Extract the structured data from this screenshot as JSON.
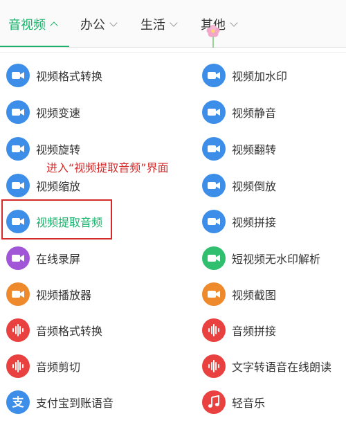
{
  "tabs": [
    {
      "label": "音视频",
      "active": true
    },
    {
      "label": "办公",
      "active": false
    },
    {
      "label": "生活",
      "active": false
    },
    {
      "label": "其他",
      "active": false
    }
  ],
  "colors": {
    "accent": "#19b36b",
    "blue": "#3d8ee8",
    "purple": "#a056d6",
    "green": "#2fbf6e",
    "orange": "#ee8a2c",
    "red": "#e8413f",
    "annotation": "#d42a2a"
  },
  "left_items": [
    {
      "label": "视频格式转换",
      "icon": "video-camera-icon",
      "color": "blue"
    },
    {
      "label": "视频变速",
      "icon": "video-camera-icon",
      "color": "blue"
    },
    {
      "label": "视频旋转",
      "icon": "video-camera-icon",
      "color": "blue"
    },
    {
      "label": "视频缩放",
      "icon": "video-camera-icon",
      "color": "blue"
    },
    {
      "label": "视频提取音频",
      "icon": "video-camera-icon",
      "color": "blue",
      "highlighted": true
    },
    {
      "label": "在线录屏",
      "icon": "video-camera-icon",
      "color": "purple"
    },
    {
      "label": "视频播放器",
      "icon": "video-camera-icon",
      "color": "orange"
    },
    {
      "label": "音频格式转换",
      "icon": "audio-wave-icon",
      "color": "red"
    },
    {
      "label": "音频剪切",
      "icon": "audio-wave-icon",
      "color": "red"
    },
    {
      "label": "支付宝到账语音",
      "icon": "alipay-icon",
      "color": "blue"
    }
  ],
  "right_items": [
    {
      "label": "视频加水印",
      "icon": "video-camera-icon",
      "color": "blue"
    },
    {
      "label": "视频静音",
      "icon": "video-camera-icon",
      "color": "blue"
    },
    {
      "label": "视频翻转",
      "icon": "video-camera-icon",
      "color": "blue"
    },
    {
      "label": "视频倒放",
      "icon": "video-camera-icon",
      "color": "blue"
    },
    {
      "label": "视频拼接",
      "icon": "video-camera-icon",
      "color": "blue"
    },
    {
      "label": "短视频无水印解析",
      "icon": "video-camera-icon",
      "color": "green"
    },
    {
      "label": "视频截图",
      "icon": "video-camera-icon",
      "color": "orange"
    },
    {
      "label": "音频拼接",
      "icon": "audio-wave-icon",
      "color": "red"
    },
    {
      "label": "文字转语音在线朗读",
      "icon": "audio-wave-icon",
      "color": "red"
    },
    {
      "label": "轻音乐",
      "icon": "music-note-icon",
      "color": "red"
    }
  ],
  "annotation": "进入“视频提取音频”界面"
}
